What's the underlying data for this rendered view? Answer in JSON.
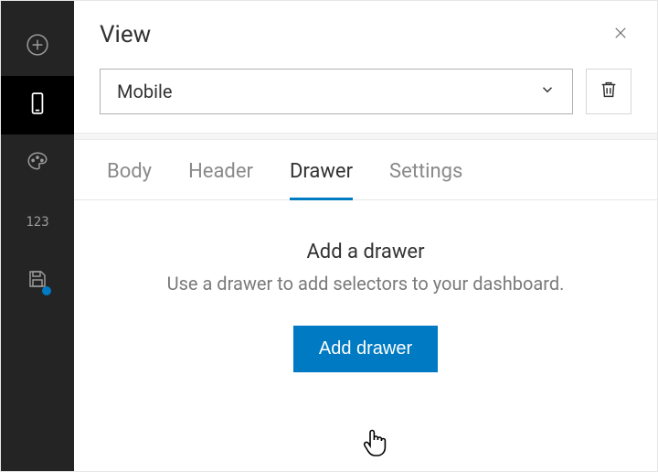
{
  "header": {
    "title": "View"
  },
  "select": {
    "value": "Mobile"
  },
  "tabs": [
    {
      "label": "Body",
      "active": false
    },
    {
      "label": "Header",
      "active": false
    },
    {
      "label": "Drawer",
      "active": true
    },
    {
      "label": "Settings",
      "active": false
    }
  ],
  "drawer": {
    "title": "Add a drawer",
    "description": "Use a drawer to add selectors to your dashboard.",
    "button_label": "Add drawer"
  },
  "sidebar": {
    "items": [
      {
        "name": "add",
        "active": false
      },
      {
        "name": "mobile",
        "active": true
      },
      {
        "name": "theme",
        "active": false
      },
      {
        "name": "numbers",
        "label": "123",
        "active": false
      },
      {
        "name": "save",
        "active": false
      }
    ]
  }
}
